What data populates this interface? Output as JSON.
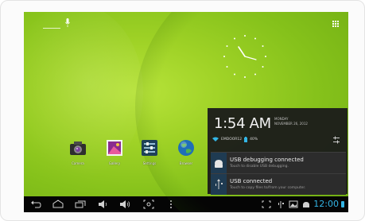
{
  "apps": [
    {
      "label": "Camera"
    },
    {
      "label": "Gallery"
    },
    {
      "label": "Settings"
    },
    {
      "label": "Browser"
    }
  ],
  "notifications_panel": {
    "time": "1:54 AM",
    "day": "MONDAY",
    "date": "NOVEMBER 26, 2012",
    "network": "EMDOOR12",
    "battery": "40%",
    "cards": [
      {
        "title": "USB debugging connected",
        "subtitle": "Touch to disable USB debugging."
      },
      {
        "title": "USB connected",
        "subtitle": "Touch to copy files to/from your computer."
      }
    ]
  },
  "status_bar": {
    "time": "12:00",
    "accent_color": "#33b5e5"
  }
}
